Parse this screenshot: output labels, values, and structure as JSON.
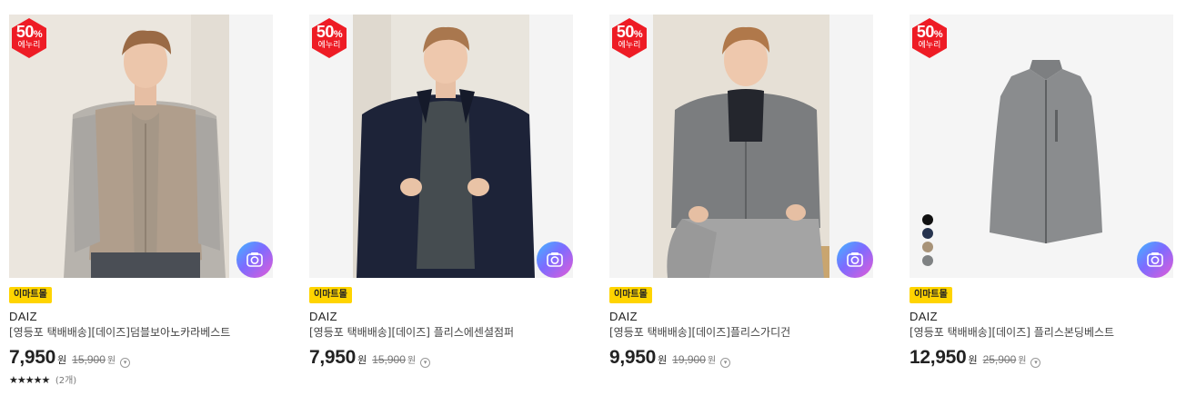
{
  "products": [
    {
      "badge_pct": "50",
      "badge_pct_unit": "%",
      "badge_label": "에누리",
      "mall_tag": "이마트몰",
      "brand": "DAIZ",
      "title": "[영등포 택배배송][데이즈]덤블보아노카라베스트",
      "price": "7,950",
      "price_unit": "원",
      "original_price": "15,900",
      "original_unit": "원",
      "stars": "★★★★★",
      "reviews": "(2개)",
      "image": "model-tan-boa-vest"
    },
    {
      "badge_pct": "50",
      "badge_pct_unit": "%",
      "badge_label": "에누리",
      "mall_tag": "이마트몰",
      "brand": "DAIZ",
      "title": "[영등포 택배배송][데이즈] 플리스에센셜점퍼",
      "price": "7,950",
      "price_unit": "원",
      "original_price": "15,900",
      "original_unit": "원",
      "image": "model-navy-fleece-jumper"
    },
    {
      "badge_pct": "50",
      "badge_pct_unit": "%",
      "badge_label": "에누리",
      "mall_tag": "이마트몰",
      "brand": "DAIZ",
      "title": "[영등포 택배배송][데이즈]플리스가디건",
      "price": "9,950",
      "price_unit": "원",
      "original_price": "19,900",
      "original_unit": "원",
      "image": "model-grey-fleece-cardigan"
    },
    {
      "badge_pct": "50",
      "badge_pct_unit": "%",
      "badge_label": "에누리",
      "mall_tag": "이마트몰",
      "brand": "DAIZ",
      "title": "[영등포 택배배송][데이즈] 플리스본딩베스트",
      "price": "12,950",
      "price_unit": "원",
      "original_price": "25,900",
      "original_unit": "원",
      "image": "grey-fleece-vest-flat",
      "color_swatches": [
        "#111111",
        "#27344f",
        "#a89378",
        "#7f8283"
      ]
    }
  ],
  "colors": {
    "badge_red": "#ee1c25",
    "mall_tag_yellow": "#ffd400",
    "camera_gradient": [
      "#3fb8ff",
      "#7d6bff",
      "#e45bd6"
    ]
  },
  "icons": {
    "camera_button": "camera-icon",
    "price_info": "info-circle-icon"
  }
}
